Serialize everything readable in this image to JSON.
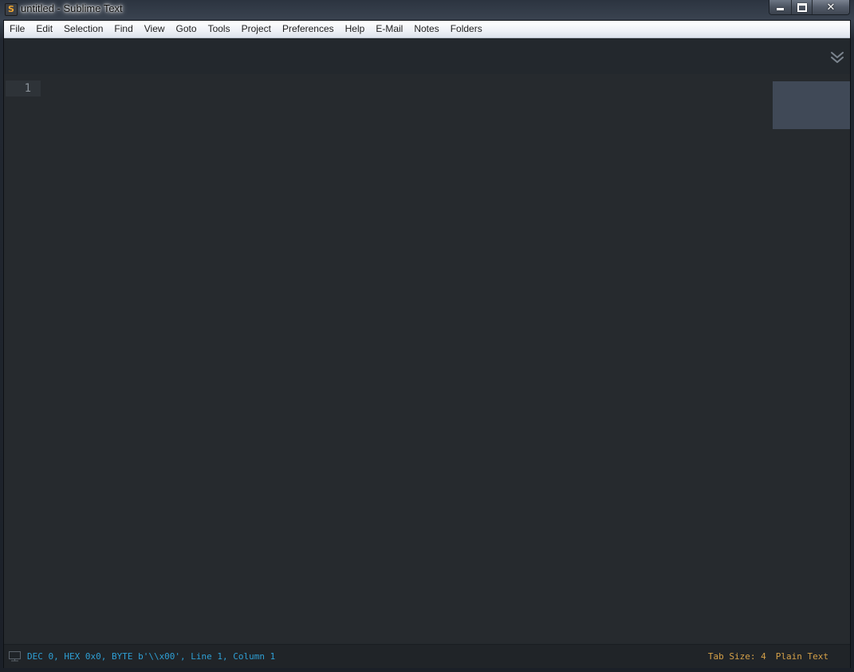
{
  "window": {
    "title": "untitled - Sublime Text",
    "app_icon_glyph": "S",
    "controls": {
      "minimize": "minimize-icon",
      "maximize": "maximize-icon",
      "close": "✕"
    }
  },
  "menubar": {
    "items": [
      "File",
      "Edit",
      "Selection",
      "Find",
      "View",
      "Goto",
      "Tools",
      "Project",
      "Preferences",
      "Help",
      "E-Mail",
      "Notes",
      "Folders"
    ]
  },
  "tabbar": {
    "overflow_icon": "chevron-double-down-icon"
  },
  "editor": {
    "line_numbers": [
      "1"
    ],
    "content": ""
  },
  "statusbar": {
    "left_text": "DEC 0, HEX 0x0, BYTE b'\\\\x00', Line 1, Column 1",
    "tab_size": "Tab Size: 4",
    "syntax": "Plain Text"
  },
  "colors": {
    "editor_bg": "#262a2e",
    "status_left": "#2e9fd4",
    "status_right": "#d4a048",
    "minimap_viewport": "#404957"
  }
}
